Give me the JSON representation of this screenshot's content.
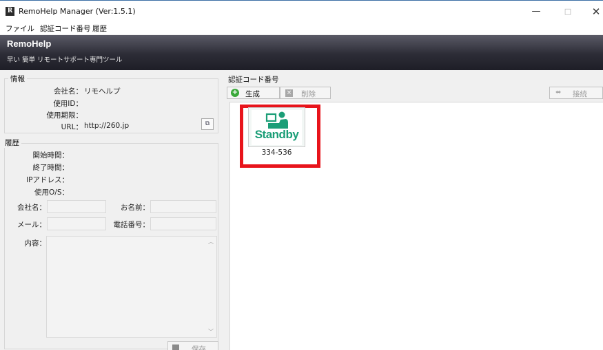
{
  "window": {
    "title": "RemoHelp Manager (Ver:1.5.1)",
    "app_icon_letter": "R",
    "minimize": "—",
    "maximize": "□",
    "close": "✕"
  },
  "menu": [
    "ファイル",
    "認証コード番号",
    "履歴"
  ],
  "banner": {
    "brand": "RemoHelp",
    "tagline": "早い 簡単 リモートサポート専門ツール"
  },
  "info": {
    "section_title": "情報",
    "company_label": "会社名：",
    "company_value": "リモヘルプ",
    "use_id_label": "使用ID：",
    "expiry_label": "使用期限：",
    "url_label": "URL：",
    "url_value": "http://260.jp"
  },
  "history": {
    "section_title": "履歴",
    "start_label": "開始時間：",
    "end_label": "終了時間：",
    "ip_label": "IPアドレス：",
    "os_label": "使用O/S：",
    "company_label": "会社名：",
    "name_label": "お名前：",
    "mail_label": "メール：",
    "phone_label": "電話番号：",
    "content_label": "内容：",
    "save_label": "保存"
  },
  "codes": {
    "section_title": "認証コード番号",
    "generate_label": "生成",
    "delete_label": "削除",
    "connect_label": "接続",
    "items": [
      {
        "status": "Standby",
        "code": "334-536"
      }
    ]
  },
  "colors": {
    "highlight": "#e8141b",
    "standby_green": "#1b9e77",
    "banner_dark": "#2c2c36"
  },
  "icons": {
    "generate": "plus-circle-icon",
    "delete": "x-box-icon",
    "connect": "double-arrow-icon",
    "copy": "copy-icon",
    "save": "floppy-icon"
  }
}
